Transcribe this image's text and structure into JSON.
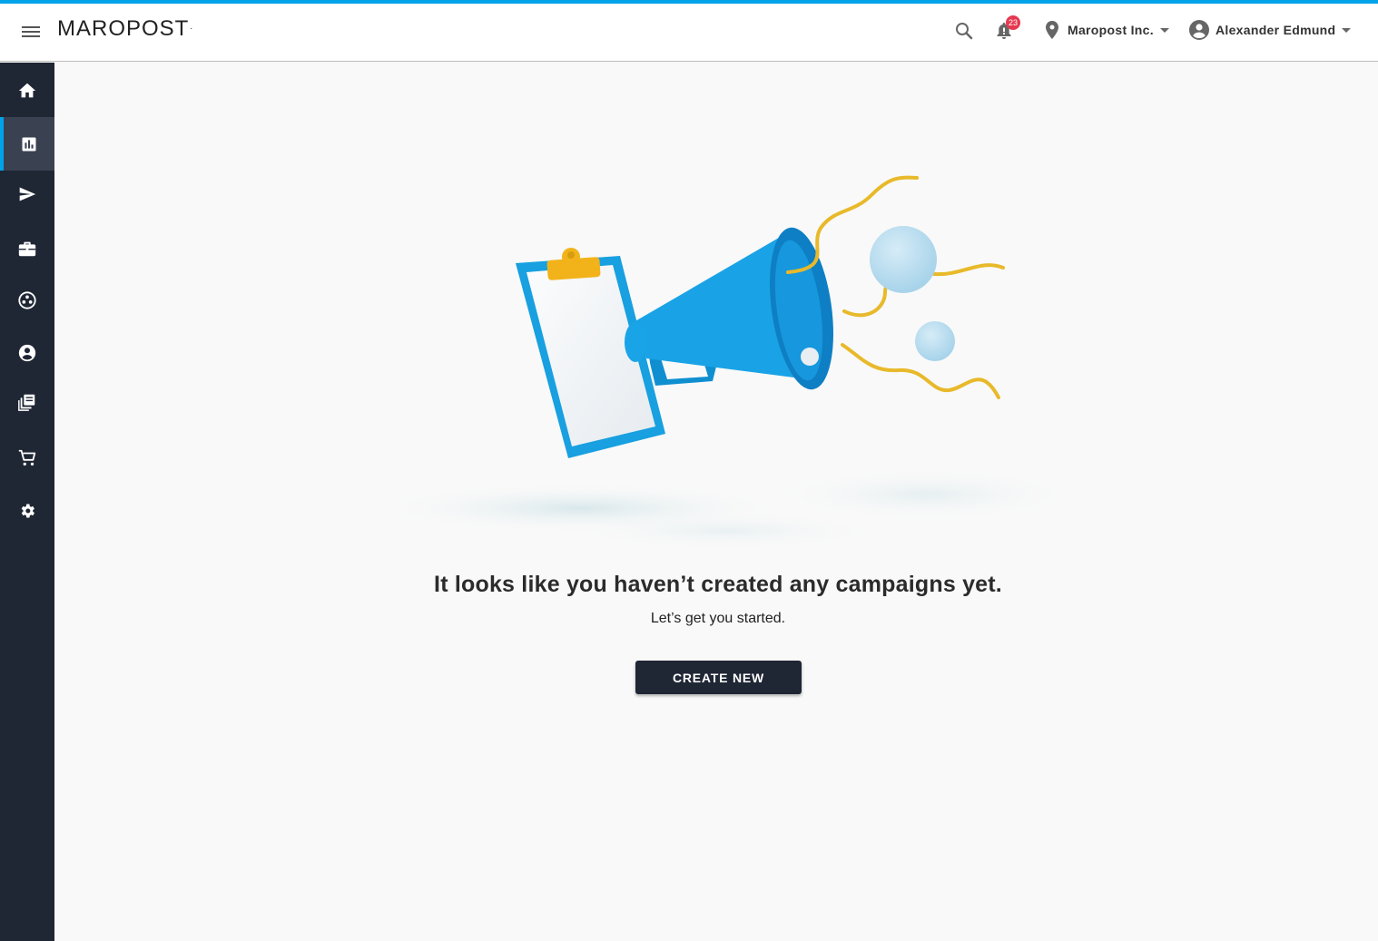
{
  "header": {
    "logo": "MAROPOST",
    "logo_mark": ".",
    "notification_count": "23",
    "org_name": "Maropost Inc.",
    "user_name": "Alexander Edmund"
  },
  "sidebar": {
    "items": [
      {
        "name": "home",
        "icon": "home-icon"
      },
      {
        "name": "analytics",
        "icon": "bar-chart-icon",
        "active": true
      },
      {
        "name": "campaigns",
        "icon": "send-icon"
      },
      {
        "name": "briefcase",
        "icon": "briefcase-icon"
      },
      {
        "name": "segments",
        "icon": "dots-circle-icon"
      },
      {
        "name": "contacts",
        "icon": "account-circle-icon"
      },
      {
        "name": "library",
        "icon": "library-icon"
      },
      {
        "name": "commerce",
        "icon": "cart-icon"
      },
      {
        "name": "settings",
        "icon": "gear-icon"
      }
    ]
  },
  "empty_state": {
    "title": "It looks like you haven’t created any campaigns yet.",
    "subtitle": "Let’s get you started.",
    "button_label": "CREATE NEW"
  },
  "colors": {
    "accent": "#00a3e8",
    "sidebar": "#1f2634",
    "badge": "#e53950",
    "button": "#1f2634"
  }
}
